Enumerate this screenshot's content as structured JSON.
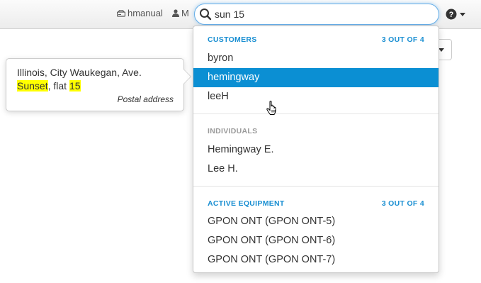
{
  "topbar": {
    "user1_label": "hmanual",
    "user2_label": "M",
    "search_value": "sun 15"
  },
  "popover": {
    "line1": "Illinois, City Waukegan, Ave.",
    "line2_hl1": "Sunset",
    "line2_mid": ", flat ",
    "line2_hl2": "15",
    "caption": "Postal address"
  },
  "dropdown": {
    "customers": {
      "header": "CUSTOMERS",
      "count": "3 OUT OF 4",
      "items": [
        "byron",
        "hemingway",
        "leeH"
      ]
    },
    "individuals": {
      "header": "INDIVIDUALS",
      "items": [
        "Hemingway E.",
        "Lee H."
      ]
    },
    "equipment": {
      "header": "ACTIVE EQUIPMENT",
      "count": "3 OUT OF 4",
      "items": [
        "GPON ONT (GPON ONT-5)",
        "GPON ONT (GPON ONT-6)",
        "GPON ONT (GPON ONT-7)"
      ]
    }
  },
  "icons": {
    "user1": "disk-icon",
    "user2": "user-icon",
    "search": "search-icon",
    "help": "help-icon",
    "cursor": "hand-pointer-icon"
  },
  "colors": {
    "accent": "#0b8fd3",
    "header_blue": "#1a8fd2",
    "highlight": "#ffff00"
  }
}
